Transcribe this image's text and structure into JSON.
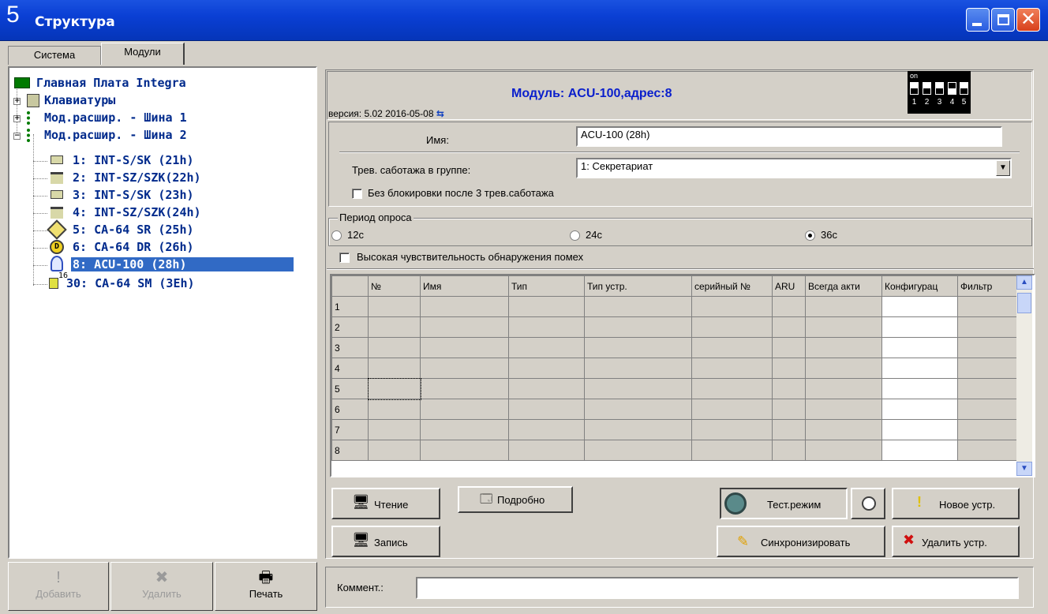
{
  "window": {
    "number": "5",
    "title": "Структура"
  },
  "tabs": [
    {
      "label": "Система"
    },
    {
      "label": "Модули"
    }
  ],
  "tree": {
    "root": "Главная Плата Integra",
    "keypads": "Клавиатуры",
    "bus1": "Мод.расшир. - Шина 1",
    "bus2": "Мод.расшир. - Шина 2",
    "modules": [
      {
        "label": "1: INT-S/SK   (21h)"
      },
      {
        "label": "2: INT-SZ/SZK(22h)"
      },
      {
        "label": "3: INT-S/SK   (23h)"
      },
      {
        "label": "4: INT-SZ/SZK(24h)"
      },
      {
        "label": "5: CA-64 SR   (25h)"
      },
      {
        "label": "6: CA-64 DR   (26h)"
      },
      {
        "label": "8: ACU-100    (28h)"
      },
      {
        "label": "30: CA-64 SM  (3Eh)"
      }
    ],
    "icon_badges": {
      "sm_badge": "16",
      "dr_letter": "D"
    }
  },
  "left_buttons": {
    "add": "Добавить",
    "delete": "Удалить",
    "print": "Печать"
  },
  "module": {
    "title": "Модуль: ACU-100,адрес:8",
    "version": "версия: 5.02 2016-05-08",
    "dip": {
      "on_label": "on",
      "numbers": [
        "1",
        "2",
        "3",
        "4",
        "5"
      ]
    }
  },
  "form": {
    "name_label": "Имя:",
    "name_value": "ACU-100  (28h)",
    "tamper_label": "Трев. саботажа в группе:",
    "tamper_value": "1: Секретариат",
    "no_block_label": "Без блокировки после 3 трев.саботажа",
    "poll_group": "Период опроса",
    "poll_options": [
      "12с",
      "24с",
      "36с"
    ],
    "poll_selected": 2,
    "high_sens_label": "Высокая чувствительность обнаружения помех"
  },
  "grid": {
    "columns": [
      "№",
      "Имя",
      "Тип",
      "Тип устр.",
      "серийный №",
      "ARU",
      "Всегда акти",
      "Конфигурац",
      "Фильтр"
    ],
    "rows": [
      "1",
      "2",
      "3",
      "4",
      "5",
      "6",
      "7",
      "8"
    ]
  },
  "buttons": {
    "read": "Чтение",
    "write": "Запись",
    "details": "Подробно",
    "test_mode": "Тест.режим",
    "sync": "Синхронизировать",
    "new_device": "Новое устр.",
    "delete_device": "Удалить устр."
  },
  "comment": {
    "label": "Коммент.:",
    "value": ""
  },
  "colors": {
    "title_bar": "#0a3fd4",
    "selection": "#316ac5",
    "tree_text": "#002a8c",
    "module_title": "#0a1fcc"
  }
}
